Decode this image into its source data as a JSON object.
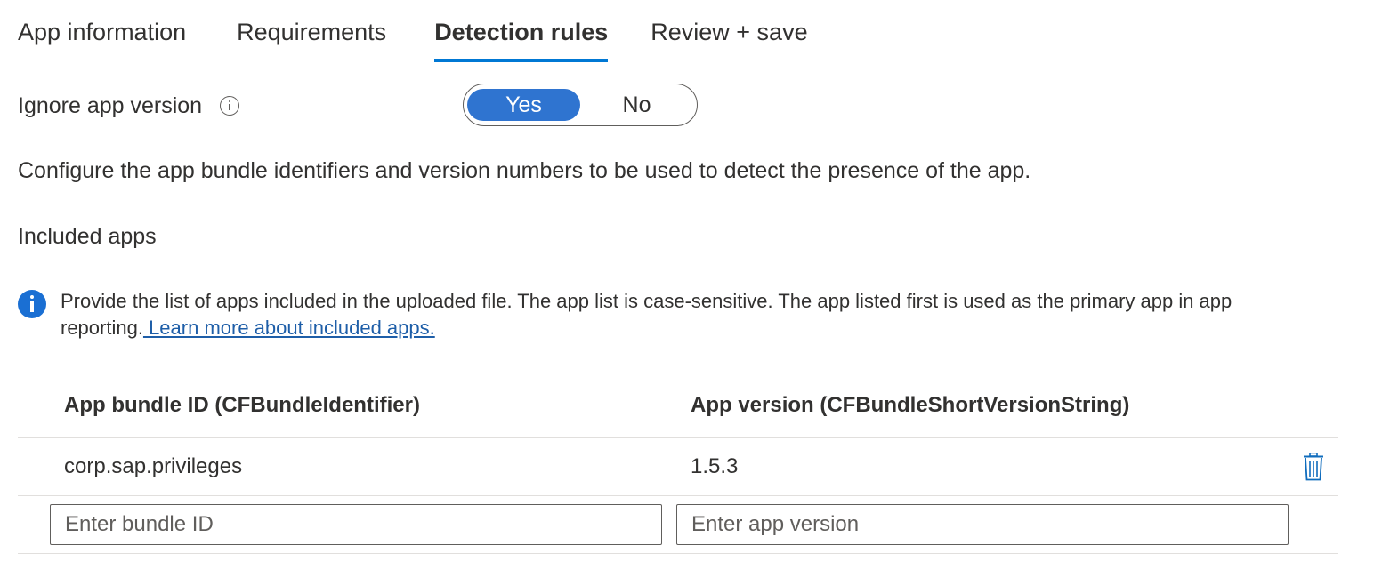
{
  "tabs": [
    {
      "label": "App information"
    },
    {
      "label": "Requirements"
    },
    {
      "label": "Detection rules"
    },
    {
      "label": "Review + save"
    }
  ],
  "active_tab": "Detection rules",
  "ignore_version": {
    "label": "Ignore app version",
    "options": {
      "yes": "Yes",
      "no": "No"
    },
    "selected": "Yes"
  },
  "description": "Configure the app bundle identifiers and version numbers to be used to detect the presence of the app.",
  "included_apps_label": "Included apps",
  "info_banner": {
    "text": "Provide the list of apps included in the uploaded file. The app list is case-sensitive. The app listed first is used as the primary app in app reporting.",
    "link_text": " Learn more about included apps."
  },
  "table": {
    "headers": {
      "bundle_id": "App bundle ID (CFBundleIdentifier)",
      "version": "App version (CFBundleShortVersionString)"
    },
    "rows": [
      {
        "bundle_id": "corp.sap.privileges",
        "version": "1.5.3"
      }
    ],
    "new_row": {
      "bundle_placeholder": "Enter bundle ID",
      "version_placeholder": "Enter app version",
      "bundle_value": "",
      "version_value": ""
    }
  },
  "colors": {
    "accent": "#0078d4",
    "toggle_selected": "#2f74d0",
    "link": "#1e5ea8",
    "info_icon": "#1a6fd3"
  },
  "icons": {
    "info_tooltip": "info-outline-icon",
    "banner": "info-filled-icon",
    "delete": "trash-icon"
  }
}
